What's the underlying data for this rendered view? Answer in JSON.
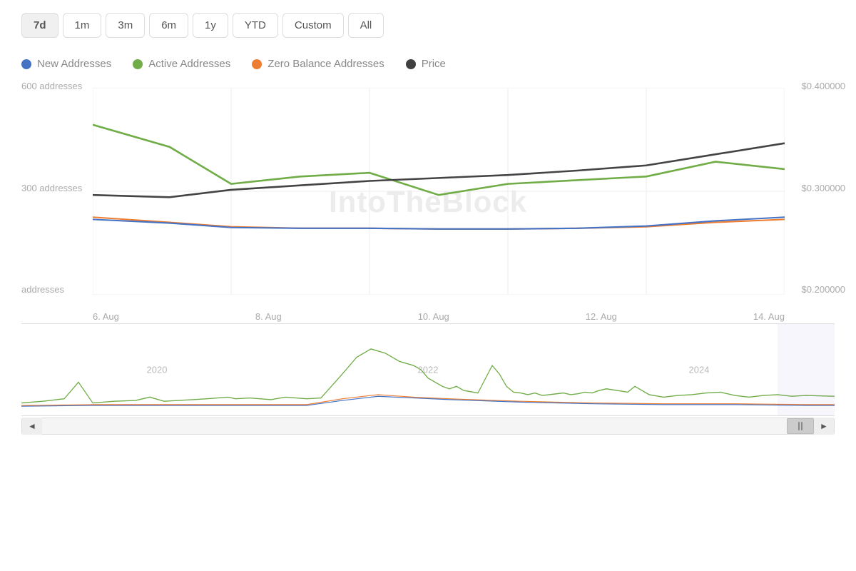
{
  "timeButtons": [
    {
      "label": "7d",
      "active": true
    },
    {
      "label": "1m",
      "active": false
    },
    {
      "label": "3m",
      "active": false
    },
    {
      "label": "6m",
      "active": false
    },
    {
      "label": "1y",
      "active": false
    },
    {
      "label": "YTD",
      "active": false
    },
    {
      "label": "Custom",
      "active": false
    },
    {
      "label": "All",
      "active": false
    }
  ],
  "legend": [
    {
      "label": "New Addresses",
      "color": "#4472c4",
      "id": "new-addresses"
    },
    {
      "label": "Active Addresses",
      "color": "#70ad47",
      "id": "active-addresses"
    },
    {
      "label": "Zero Balance Addresses",
      "color": "#ed7d31",
      "id": "zero-balance"
    },
    {
      "label": "Price",
      "color": "#404040",
      "id": "price"
    }
  ],
  "yAxisLeft": [
    "600 addresses",
    "300 addresses",
    "addresses"
  ],
  "yAxisRight": [
    "$0.400000",
    "$0.300000",
    "$0.200000"
  ],
  "xAxisLabels": [
    "6. Aug",
    "8. Aug",
    "10. Aug",
    "12. Aug",
    "14. Aug"
  ],
  "miniYearLabels": [
    "2020",
    "2022",
    "2024"
  ],
  "watermark": "IntoTheBlock",
  "scrollLeft": "◄",
  "scrollRight": "►"
}
